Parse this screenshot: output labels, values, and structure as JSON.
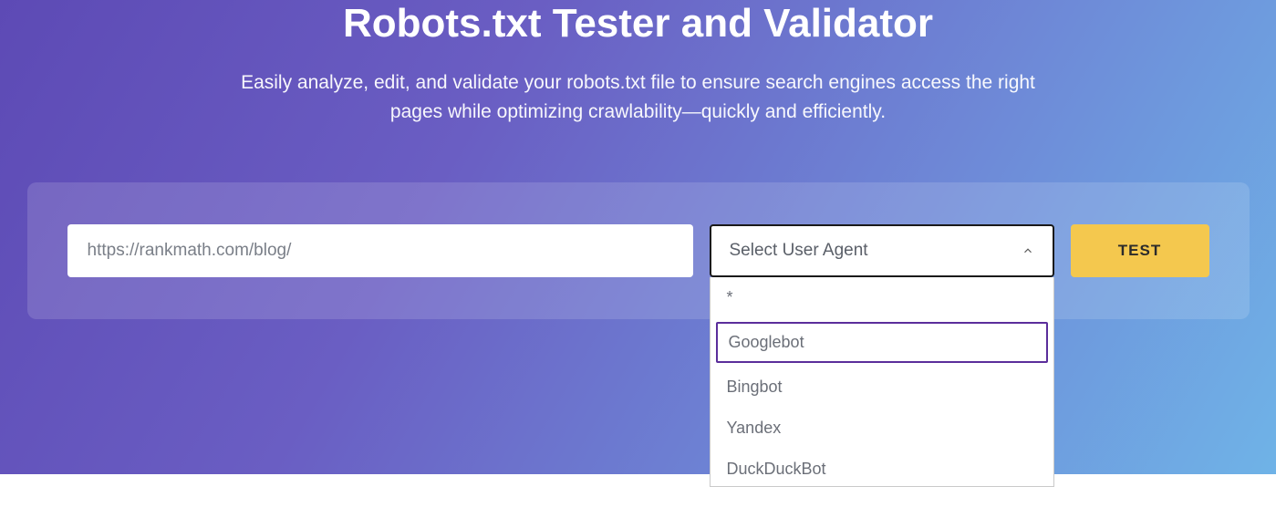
{
  "hero": {
    "title": "Robots.txt Tester and Validator",
    "subtitle": "Easily analyze, edit, and validate your robots.txt file to ensure search engines access the right pages while optimizing crawlability—quickly and efficiently."
  },
  "form": {
    "url_placeholder": "https://rankmath.com/blog/",
    "url_value": "https://rankmath.com/blog/",
    "select_label": "Select User Agent",
    "options": [
      "*",
      "Googlebot",
      "Bingbot",
      "Yandex",
      "DuckDuckBot"
    ],
    "highlighted_option_index": 1,
    "test_label": "TEST"
  }
}
